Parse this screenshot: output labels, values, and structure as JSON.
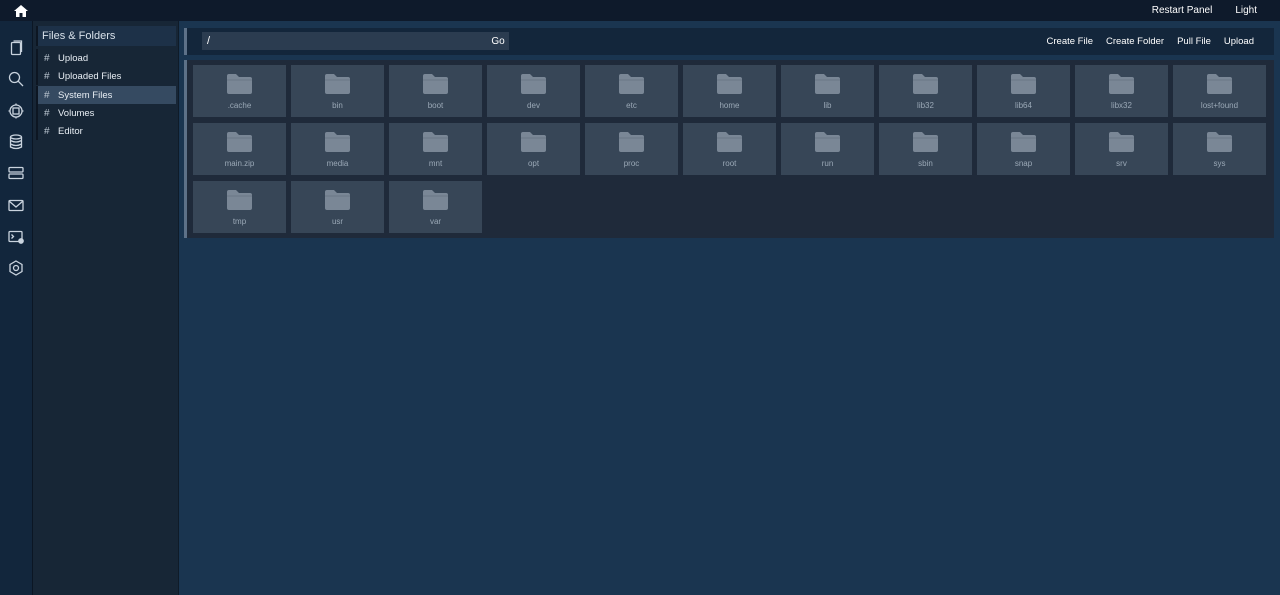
{
  "topbar": {
    "home_icon": "home-icon",
    "restart_label": "Restart Panel",
    "theme_label": "Light"
  },
  "iconbar": {
    "icons": [
      "files-icon",
      "search-icon",
      "cpu-icon",
      "database-icon",
      "server-icon",
      "mail-icon",
      "terminal-icon",
      "settings-icon"
    ]
  },
  "sidebar": {
    "title": "Files & Folders",
    "items": [
      {
        "label": "Upload"
      },
      {
        "label": "Uploaded Files"
      },
      {
        "label": "System Files",
        "active": true
      },
      {
        "label": "Volumes"
      },
      {
        "label": "Editor"
      }
    ]
  },
  "pathbar": {
    "path_value": "/",
    "go_label": "Go",
    "actions": [
      "Create File",
      "Create Folder",
      "Pull File",
      "Upload"
    ]
  },
  "folders": [
    ".cache",
    "bin",
    "boot",
    "dev",
    "etc",
    "home",
    "lib",
    "lib32",
    "lib64",
    "libx32",
    "lost+found",
    "main.zip",
    "media",
    "mnt",
    "opt",
    "proc",
    "root",
    "run",
    "sbin",
    "snap",
    "srv",
    "sys",
    "tmp",
    "usr",
    "var"
  ],
  "colors": {
    "background": "#1a3550",
    "topbar": "#0e1a2b",
    "tile": "#374657",
    "folder_icon": "#7a8796"
  }
}
